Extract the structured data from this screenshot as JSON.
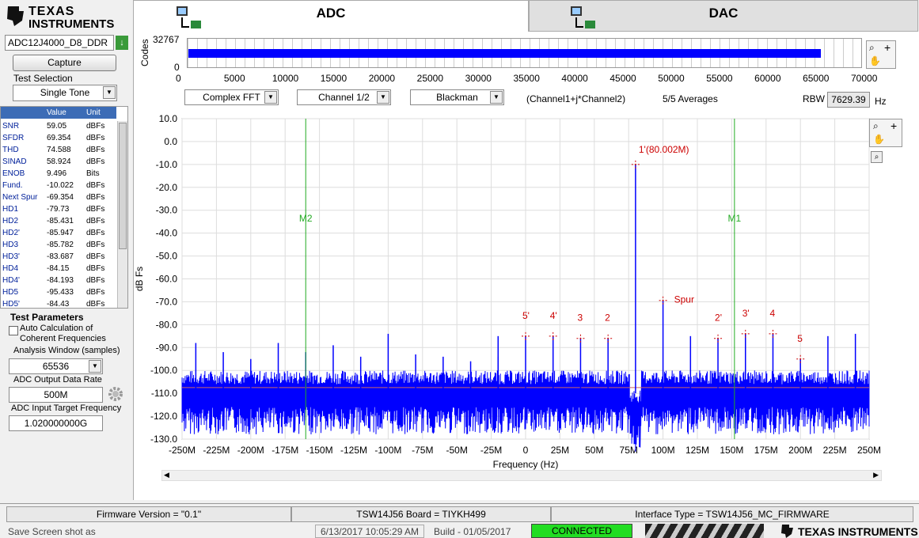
{
  "brand": {
    "line1": "TEXAS",
    "line2": "INSTRUMENTS"
  },
  "tabs": [
    {
      "label": "ADC"
    },
    {
      "label": "DAC"
    }
  ],
  "device": {
    "value": "ADC12J4000_D8_DDR"
  },
  "capture_label": "Capture",
  "test_selection": {
    "label": "Test Selection",
    "value": "Single Tone"
  },
  "table": {
    "headers": [
      "",
      "Value",
      "Unit"
    ],
    "rows": [
      [
        "SNR",
        "59.05",
        "dBFs"
      ],
      [
        "SFDR",
        "69.354",
        "dBFs"
      ],
      [
        "THD",
        "74.588",
        "dBFs"
      ],
      [
        "SINAD",
        "58.924",
        "dBFs"
      ],
      [
        "ENOB",
        "9.496",
        "Bits"
      ],
      [
        "Fund.",
        "-10.022",
        "dBFs"
      ],
      [
        "Next Spur",
        "-69.354",
        "dBFs"
      ],
      [
        "HD1",
        "-79.73",
        "dBFs"
      ],
      [
        "HD2",
        "-85.431",
        "dBFs"
      ],
      [
        "HD2'",
        "-85.947",
        "dBFs"
      ],
      [
        "HD3",
        "-85.782",
        "dBFs"
      ],
      [
        "HD3'",
        "-83.687",
        "dBFs"
      ],
      [
        "HD4",
        "-84.15",
        "dBFs"
      ],
      [
        "HD4'",
        "-84.193",
        "dBFs"
      ],
      [
        "HD5",
        "-95.433",
        "dBFs"
      ],
      [
        "HD5'",
        "-84.43",
        "dBFs"
      ]
    ]
  },
  "params": {
    "title": "Test Parameters",
    "auto_calc": "Auto Calculation of",
    "auto_calc2": "Coherent Frequencies",
    "window_label": "Analysis Window (samples)",
    "window_value": "65536",
    "rate_label": "ADC Output Data Rate",
    "rate_value": "500M",
    "target_label": "ADC Input Target Frequency",
    "target_value": "1.020000000G"
  },
  "codes_plot": {
    "ylabel": "Codes",
    "ymax": "32767",
    "ymin": "0",
    "xticks": [
      "0",
      "5000",
      "10000",
      "15000",
      "20000",
      "25000",
      "30000",
      "35000",
      "40000",
      "45000",
      "50000",
      "55000",
      "60000",
      "65000",
      "70000"
    ],
    "xmax": 70000,
    "filled_to": 65536
  },
  "controls": {
    "fft": "Complex FFT",
    "channel": "Channel 1/2",
    "window": "Blackman",
    "formula": "(Channel1+j*Channel2)",
    "averages": "5/5 Averages",
    "rbw_label": "RBW",
    "rbw_value": "7629.39",
    "rbw_unit": "Hz"
  },
  "chart_data": {
    "type": "line",
    "xlabel": "Frequency (Hz)",
    "ylabel": "dB Fs",
    "xlim": [
      -250,
      250
    ],
    "ylim": [
      -130,
      10
    ],
    "xticks": [
      "-250M",
      "-225M",
      "-200M",
      "-175M",
      "-150M",
      "-125M",
      "-100M",
      "-75M",
      "-50M",
      "-25M",
      "0",
      "25M",
      "50M",
      "75M",
      "100M",
      "125M",
      "150M",
      "175M",
      "200M",
      "225M",
      "250M"
    ],
    "yticks": [
      "10.0",
      "0.0",
      "-10.0",
      "-20.0",
      "-30.0",
      "-40.0",
      "-50.0",
      "-60.0",
      "-70.0",
      "-80.0",
      "-90.0",
      "-100.0",
      "-110.0",
      "-120.0",
      "-130.0"
    ],
    "noise_floor_db": -110,
    "reference_line_db": -107.5,
    "peaks": [
      {
        "x": 80,
        "y": -10
      },
      {
        "x": 100,
        "y": -69.4
      },
      {
        "x": -240,
        "y": -88
      },
      {
        "x": -220,
        "y": -92
      },
      {
        "x": -200,
        "y": -95
      },
      {
        "x": -180,
        "y": -88
      },
      {
        "x": -160,
        "y": -92
      },
      {
        "x": -140,
        "y": -89
      },
      {
        "x": -120,
        "y": -94
      },
      {
        "x": -100,
        "y": -84
      },
      {
        "x": -80,
        "y": -93
      },
      {
        "x": -60,
        "y": -94
      },
      {
        "x": -40,
        "y": -96
      },
      {
        "x": -20,
        "y": -94
      },
      {
        "x": -20,
        "y": -85
      },
      {
        "x": 0,
        "y": -85
      },
      {
        "x": 20,
        "y": -85
      },
      {
        "x": 40,
        "y": -86
      },
      {
        "x": 60,
        "y": -86
      },
      {
        "x": 120,
        "y": -85
      },
      {
        "x": 140,
        "y": -86
      },
      {
        "x": 160,
        "y": -84
      },
      {
        "x": 180,
        "y": -84
      },
      {
        "x": 200,
        "y": -95
      },
      {
        "x": 220,
        "y": -85
      },
      {
        "x": 240,
        "y": -84
      }
    ],
    "markers": [
      {
        "name": "M2",
        "x": -160
      },
      {
        "name": "M1",
        "x": 152
      }
    ],
    "annotations": [
      {
        "text": "1'(80.002M)",
        "x": 80,
        "y": -10
      },
      {
        "text": "Spur",
        "x": 100,
        "y": -69.4
      },
      {
        "text": "5'",
        "x": 0,
        "y": -85
      },
      {
        "text": "4'",
        "x": 20,
        "y": -85
      },
      {
        "text": "3",
        "x": 40,
        "y": -86
      },
      {
        "text": "2",
        "x": 60,
        "y": -86
      },
      {
        "text": "2'",
        "x": 140,
        "y": -86
      },
      {
        "text": "3'",
        "x": 160,
        "y": -84
      },
      {
        "text": "4",
        "x": 180,
        "y": -84
      },
      {
        "text": "5",
        "x": 200,
        "y": -95
      }
    ]
  },
  "footer": {
    "firmware": "Firmware Version = \"0.1\"",
    "board": "TSW14J56 Board = TIYKH499",
    "interface": "Interface Type = TSW14J56_MC_FIRMWARE",
    "save": "Save Screen shot as",
    "timestamp": "6/13/2017 10:05:29 AM",
    "build": "Build  - 01/05/2017",
    "status": "CONNECTED",
    "brand": "TEXAS INSTRUMENTS"
  },
  "colors": {
    "spectrum": "#0000ff",
    "marker": "#22aa22",
    "annotation": "#cc0000",
    "status_green": "#22dd22"
  }
}
